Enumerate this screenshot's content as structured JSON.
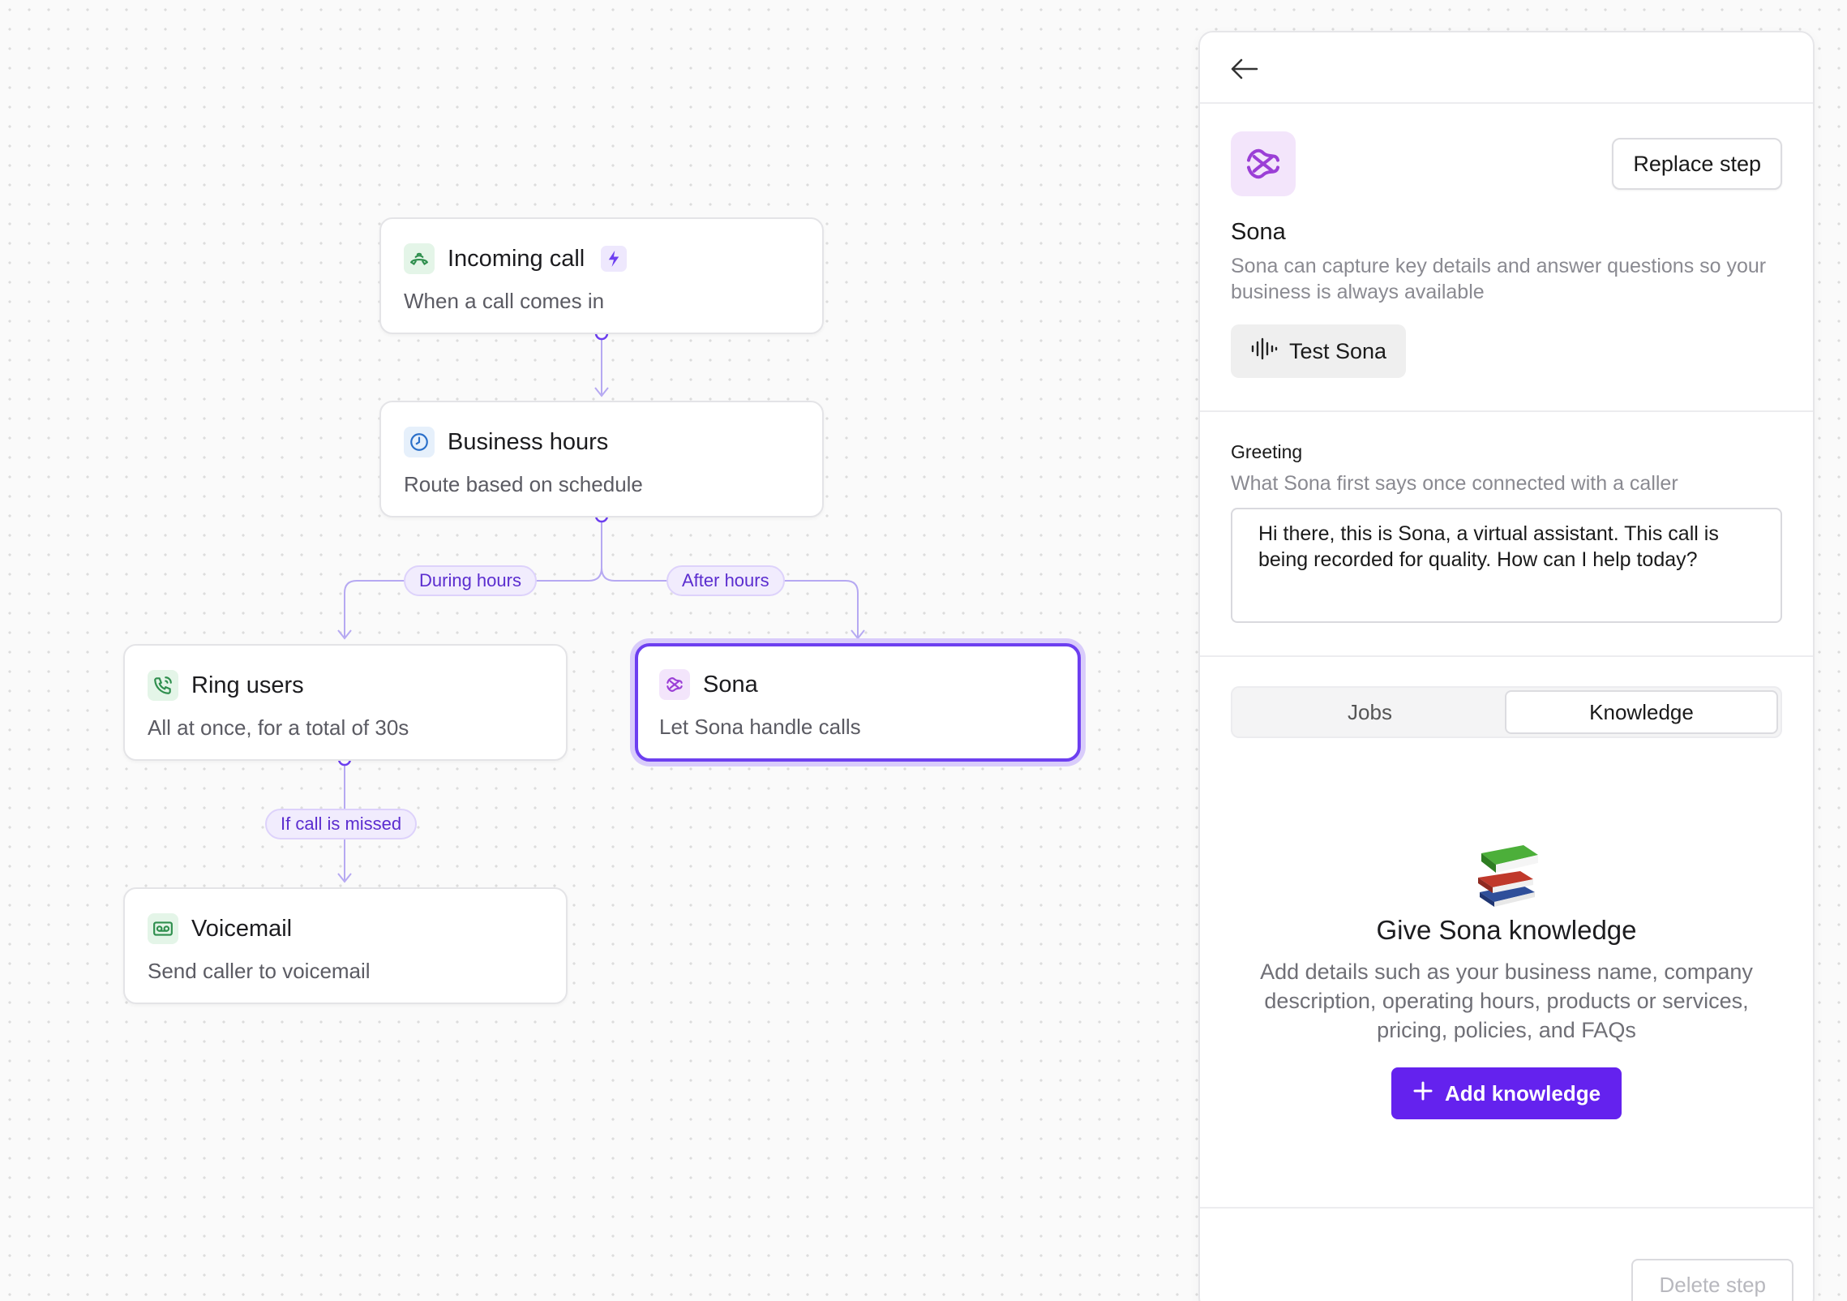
{
  "flow": {
    "incoming": {
      "title": "Incoming call",
      "subtitle": "When a call comes in"
    },
    "hours": {
      "title": "Business hours",
      "subtitle": "Route based on schedule"
    },
    "ring": {
      "title": "Ring users",
      "subtitle": "All at once, for a total of 30s"
    },
    "sona": {
      "title": "Sona",
      "subtitle": "Let Sona handle calls"
    },
    "voicemail": {
      "title": "Voicemail",
      "subtitle": "Send caller to voicemail"
    },
    "labels": {
      "during": "During hours",
      "after": "After hours",
      "missed": "If call is missed"
    }
  },
  "panel": {
    "replace_label": "Replace step",
    "name": "Sona",
    "description": "Sona can capture key details and answer questions so your business is always available",
    "test_label": "Test Sona",
    "greeting_label": "Greeting",
    "greeting_help": "What Sona first says once connected with a caller",
    "greeting_value": "Hi there, this is Sona, a virtual assistant. This call is being recorded for quality. How can I help today?",
    "tabs": [
      {
        "label": "Jobs"
      },
      {
        "label": "Knowledge"
      }
    ],
    "empty_title": "Give Sona knowledge",
    "empty_desc": "Add details such as your business name, company description, operating hours, products or services, pricing, policies, and FAQs",
    "add_label": "Add knowledge",
    "delete_label": "Delete step"
  },
  "colors": {
    "accent": "#6422ee",
    "edge": "#a99af0",
    "selected_border": "#6d3ff0"
  }
}
